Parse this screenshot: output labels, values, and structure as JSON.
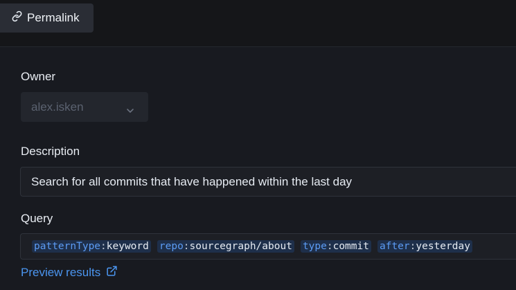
{
  "toolbar": {
    "permalink_label": "Permalink"
  },
  "form": {
    "owner": {
      "label": "Owner",
      "value": "alex.isken"
    },
    "description": {
      "label": "Description",
      "value": "Search for all commits that have happened within the last day"
    },
    "query": {
      "label": "Query",
      "tokens": [
        {
          "field": "patternType",
          "value": "keyword"
        },
        {
          "field": "repo",
          "value": "sourcegraph/about"
        },
        {
          "field": "type",
          "value": "commit"
        },
        {
          "field": "after",
          "value": "yesterday"
        }
      ]
    },
    "preview_link_label": "Preview results"
  },
  "icons": {
    "permalink": "link-icon",
    "owner_dropdown": "chevron-down-icon",
    "preview": "external-link-icon"
  },
  "colors": {
    "background": "#181a20",
    "accent": "#4b95ef",
    "token_bg": "#1e2f4a",
    "field": "#5c9cf5"
  }
}
